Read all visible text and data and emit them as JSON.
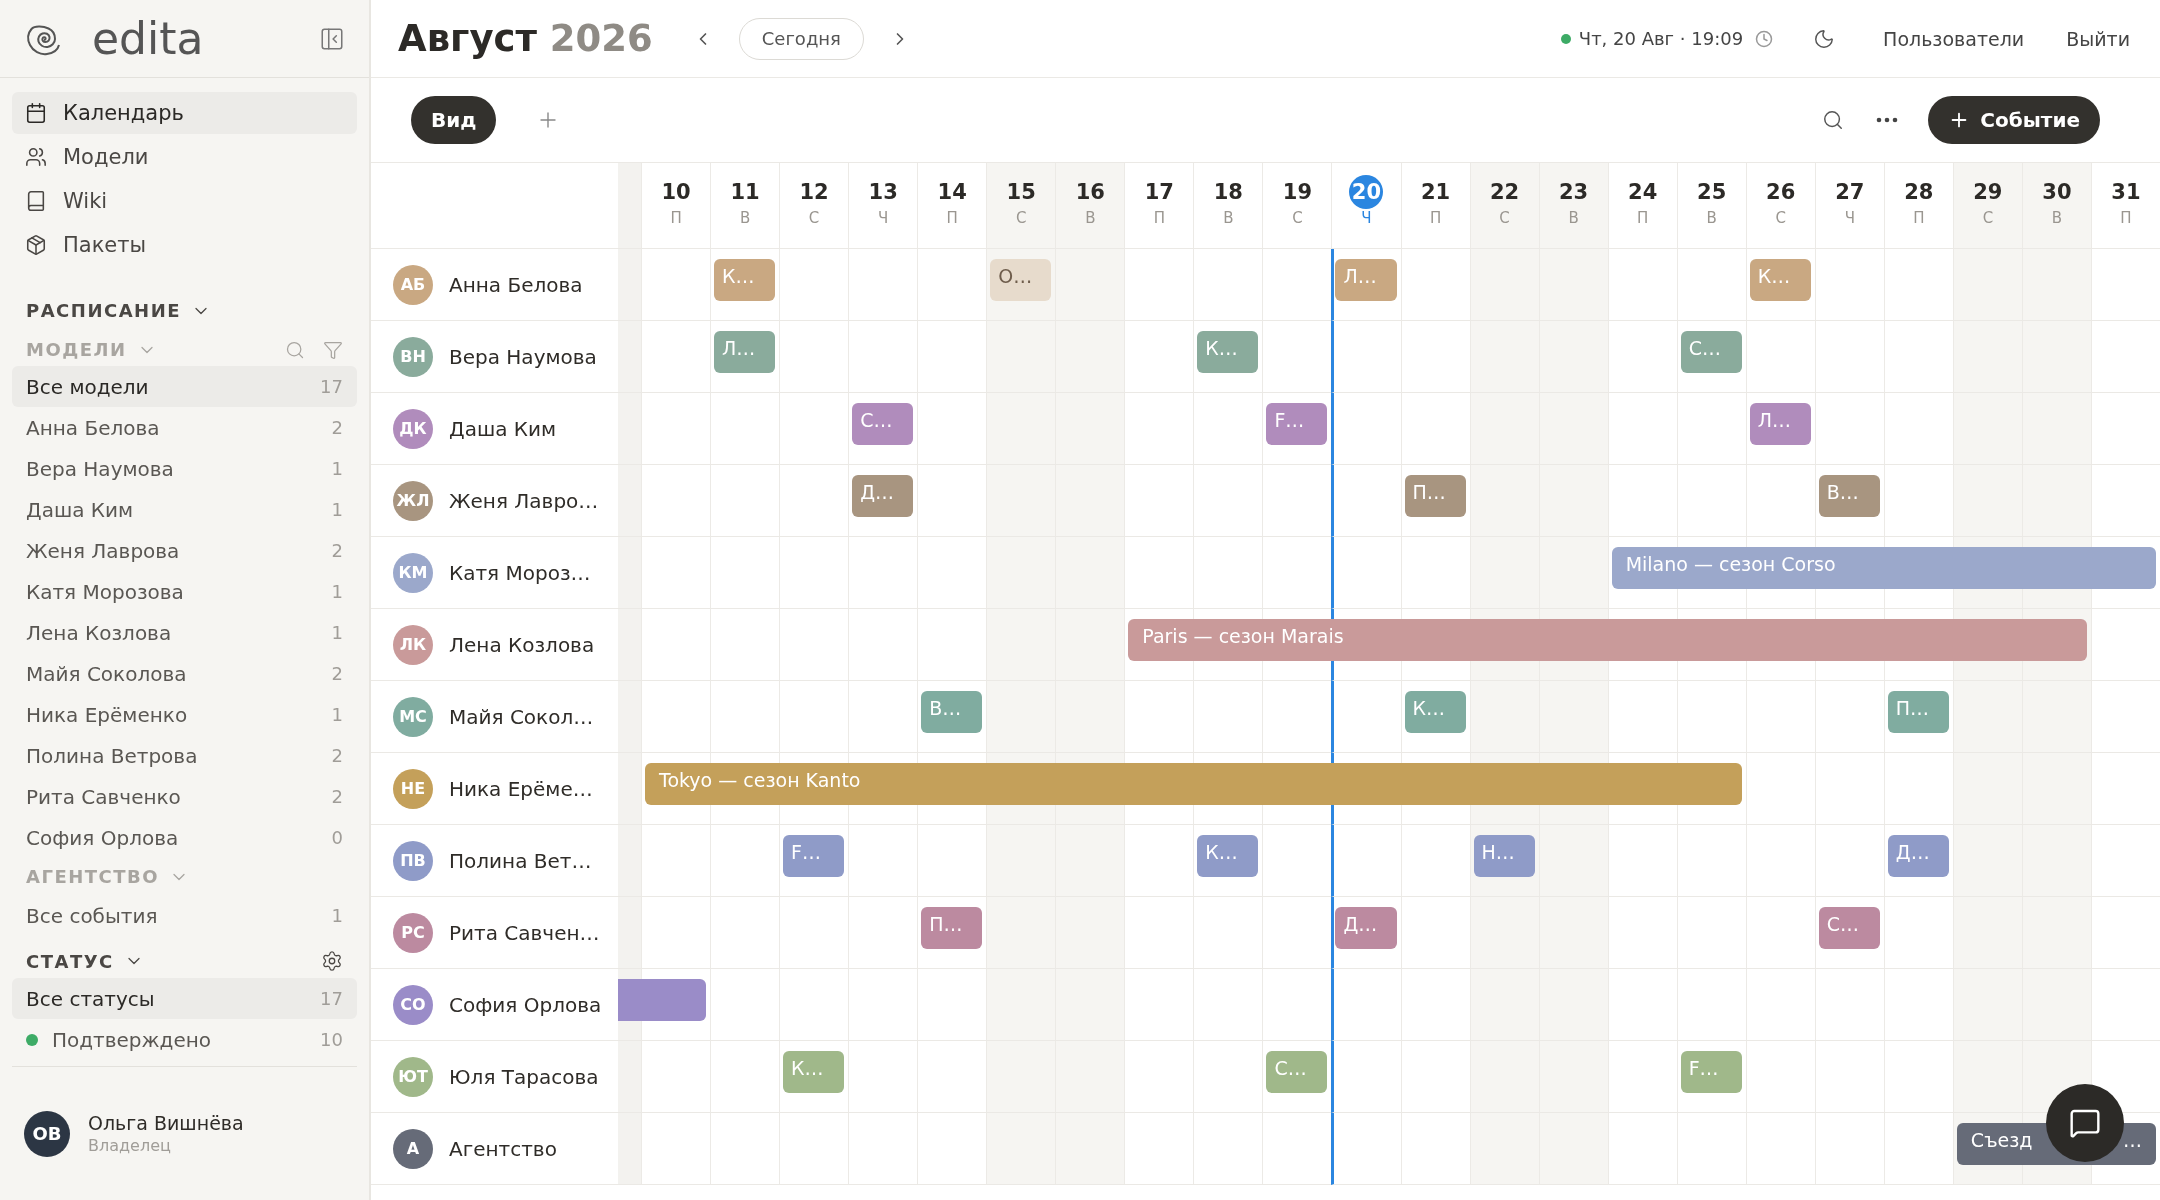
{
  "sidebar": {
    "logo": "edita",
    "nav": [
      {
        "label": "Календарь",
        "selected": true
      },
      {
        "label": "Модели",
        "selected": false
      },
      {
        "label": "Wiki",
        "selected": false
      },
      {
        "label": "Пакеты",
        "selected": false
      }
    ],
    "schedule_heading": "РАСПИСАНИЕ",
    "models_heading": "МОДЕЛИ",
    "models": [
      {
        "name": "Все модели",
        "count": "17",
        "selected": true
      },
      {
        "name": "Анна Белова",
        "count": "2",
        "selected": false
      },
      {
        "name": "Вера Наумова",
        "count": "1",
        "selected": false
      },
      {
        "name": "Даша Ким",
        "count": "1",
        "selected": false
      },
      {
        "name": "Женя Лаврова",
        "count": "2",
        "selected": false
      },
      {
        "name": "Катя Морозова",
        "count": "1",
        "selected": false
      },
      {
        "name": "Лена Козлова",
        "count": "1",
        "selected": false
      },
      {
        "name": "Майя Соколова",
        "count": "2",
        "selected": false
      },
      {
        "name": "Ника Ерёменко",
        "count": "1",
        "selected": false
      },
      {
        "name": "Полина Ветрова",
        "count": "2",
        "selected": false
      },
      {
        "name": "Рита Савченко",
        "count": "2",
        "selected": false
      },
      {
        "name": "София Орлова",
        "count": "0",
        "selected": false
      }
    ],
    "agency_heading": "АГЕНТСТВО",
    "agency": [
      {
        "name": "Все события",
        "count": "1",
        "selected": false
      }
    ],
    "status_heading": "СТАТУС",
    "statuses": [
      {
        "name": "Все статусы",
        "count": "17",
        "selected": true
      },
      {
        "name": "Подтверждено",
        "count": "10",
        "selected": false,
        "color": "#3dab66"
      }
    ],
    "user": {
      "initials": "ОВ",
      "name": "Ольга Вишнёва",
      "role": "Владелец"
    }
  },
  "header": {
    "month": "Август",
    "year": "2026",
    "today_button": "Сегодня",
    "datetime": "Чт, 20 Авг · 19:09",
    "links": [
      "Пользователи",
      "Выйти"
    ]
  },
  "toolbar": {
    "view_button": "Вид",
    "event_button": "Событие"
  },
  "days": [
    {
      "number": "10",
      "weekday": "П",
      "weekend": false,
      "today": false
    },
    {
      "number": "11",
      "weekday": "В",
      "weekend": false,
      "today": false
    },
    {
      "number": "12",
      "weekday": "С",
      "weekend": false,
      "today": false
    },
    {
      "number": "13",
      "weekday": "Ч",
      "weekend": false,
      "today": false
    },
    {
      "number": "14",
      "weekday": "П",
      "weekend": false,
      "today": false
    },
    {
      "number": "15",
      "weekday": "С",
      "weekend": true,
      "today": false
    },
    {
      "number": "16",
      "weekday": "В",
      "weekend": true,
      "today": false
    },
    {
      "number": "17",
      "weekday": "П",
      "weekend": false,
      "today": false
    },
    {
      "number": "18",
      "weekday": "В",
      "weekend": false,
      "today": false
    },
    {
      "number": "19",
      "weekday": "С",
      "weekend": false,
      "today": false
    },
    {
      "number": "20",
      "weekday": "Ч",
      "weekend": false,
      "today": true
    },
    {
      "number": "21",
      "weekday": "П",
      "weekend": false,
      "today": false
    },
    {
      "number": "22",
      "weekday": "С",
      "weekend": true,
      "today": false
    },
    {
      "number": "23",
      "weekday": "В",
      "weekend": true,
      "today": false
    },
    {
      "number": "24",
      "weekday": "П",
      "weekend": false,
      "today": false
    },
    {
      "number": "25",
      "weekday": "В",
      "weekend": false,
      "today": false
    },
    {
      "number": "26",
      "weekday": "С",
      "weekend": false,
      "today": false
    },
    {
      "number": "27",
      "weekday": "Ч",
      "weekend": false,
      "today": false
    },
    {
      "number": "28",
      "weekday": "П",
      "weekend": false,
      "today": false
    },
    {
      "number": "29",
      "weekday": "С",
      "weekend": true,
      "today": false
    },
    {
      "number": "30",
      "weekday": "В",
      "weekend": true,
      "today": false
    },
    {
      "number": "31",
      "weekday": "П",
      "weekend": false,
      "today": false
    }
  ],
  "rows": [
    {
      "initials": "АБ",
      "name": "Анна Белова",
      "color": "#c9a882",
      "cells": [
        null,
        {
          "kind": "start",
          "text": "К…",
          "faded": false
        },
        null,
        null,
        null,
        {
          "kind": "start",
          "text": "О…",
          "faded": true
        },
        null,
        null,
        null,
        null,
        {
          "kind": "start",
          "text": "Л…",
          "faded": false
        },
        null,
        null,
        null,
        null,
        null,
        {
          "kind": "start",
          "text": "К…",
          "faded": false
        }
      ]
    },
    {
      "initials": "ВН",
      "name": "Вера Наумова",
      "color": "#8aab9c",
      "cells": [
        null,
        {
          "kind": "start",
          "text": "Л…",
          "faded": false
        },
        null,
        null,
        null,
        null,
        null,
        null,
        {
          "kind": "start",
          "text": "К…",
          "faded": false
        },
        null,
        null,
        null,
        null,
        null,
        null,
        {
          "kind": "start",
          "text": "С…",
          "faded": false
        }
      ]
    },
    {
      "initials": "ДК",
      "name": "Даша Ким",
      "color": "#b08cbc",
      "cells": [
        null,
        null,
        null,
        {
          "kind": "start",
          "text": "С…",
          "faded": false
        },
        null,
        null,
        null,
        null,
        null,
        {
          "kind": "start",
          "text": "F…",
          "faded": false
        },
        null,
        null,
        null,
        null,
        null,
        null,
        {
          "kind": "start",
          "text": "Л…",
          "faded": false
        }
      ]
    },
    {
      "initials": "ЖЛ",
      "name": "Женя Лавро…",
      "color": "#a89580",
      "cells": [
        null,
        null,
        null,
        {
          "kind": "start",
          "text": "Д…",
          "faded": false
        },
        null,
        null,
        null,
        null,
        null,
        null,
        null,
        {
          "kind": "start",
          "text": "П…",
          "faded": false
        },
        null,
        null,
        null,
        null,
        null,
        {
          "kind": "start",
          "text": "В…",
          "faded": false
        }
      ]
    },
    {
      "initials": "КМ",
      "name": "Катя Мороз…",
      "color": "#9ba8cb",
      "cells": [
        null,
        null,
        null,
        null,
        null,
        null,
        null,
        null,
        null,
        null,
        null,
        null,
        null,
        null,
        {
          "kind": "start",
          "text": "Milano — сезон Corso",
          "faded": false
        },
        {
          "kind": "more"
        },
        {
          "kind": "more"
        },
        {
          "kind": "more"
        },
        {
          "kind": "more"
        },
        {
          "kind": "more"
        },
        {
          "kind": "more"
        },
        {
          "kind": "more"
        }
      ]
    },
    {
      "initials": "ЛК",
      "name": "Лена Козлова",
      "color": "#c99a9a",
      "cells": [
        null,
        null,
        null,
        null,
        null,
        null,
        null,
        {
          "kind": "start",
          "text": "Paris — сезон Marais",
          "faded": false
        },
        {
          "kind": "more"
        },
        {
          "kind": "more"
        },
        {
          "kind": "more"
        },
        {
          "kind": "more"
        },
        {
          "kind": "more"
        },
        {
          "kind": "more"
        },
        {
          "kind": "more"
        },
        {
          "kind": "more"
        },
        {
          "kind": "more"
        },
        {
          "kind": "more"
        },
        {
          "kind": "more"
        },
        {
          "kind": "more"
        },
        {
          "kind": "more"
        }
      ]
    },
    {
      "initials": "МС",
      "name": "Майя Сокол…",
      "color": "#80aca0",
      "cells": [
        null,
        null,
        null,
        null,
        {
          "kind": "start",
          "text": "В…",
          "faded": false
        },
        null,
        null,
        null,
        null,
        null,
        null,
        {
          "kind": "start",
          "text": "К…",
          "faded": false
        },
        null,
        null,
        null,
        null,
        null,
        null,
        {
          "kind": "start",
          "text": "П…",
          "faded": false
        }
      ]
    },
    {
      "initials": "НЕ",
      "name": "Ника Ерёме…",
      "color": "#c4a05a",
      "cells": [
        {
          "kind": "start",
          "text": "Tokyo — сезон Kanto",
          "faded": false
        },
        {
          "kind": "more"
        },
        {
          "kind": "more"
        },
        {
          "kind": "more"
        },
        {
          "kind": "more"
        },
        {
          "kind": "more"
        },
        {
          "kind": "more"
        },
        {
          "kind": "more"
        },
        {
          "kind": "more"
        },
        {
          "kind": "more"
        },
        {
          "kind": "more"
        },
        {
          "kind": "more"
        },
        {
          "kind": "more"
        },
        {
          "kind": "more"
        },
        {
          "kind": "more"
        },
        {
          "kind": "more"
        }
      ]
    },
    {
      "initials": "ПВ",
      "name": "Полина Вет…",
      "color": "#8f9bc8",
      "cells": [
        null,
        null,
        {
          "kind": "start",
          "text": "F…",
          "faded": false
        },
        null,
        null,
        null,
        null,
        null,
        {
          "kind": "start",
          "text": "К…",
          "faded": false
        },
        null,
        null,
        null,
        {
          "kind": "start",
          "text": "Н…",
          "faded": false
        },
        null,
        null,
        null,
        null,
        null,
        {
          "kind": "start",
          "text": "Д…",
          "faded": false
        }
      ]
    },
    {
      "initials": "РС",
      "name": "Рита Савчен…",
      "color": "#bc8aa0",
      "cells": [
        null,
        null,
        null,
        null,
        {
          "kind": "start",
          "text": "П…",
          "faded": false
        },
        null,
        null,
        null,
        null,
        null,
        {
          "kind": "start",
          "text": "Д…",
          "faded": false
        },
        null,
        null,
        null,
        null,
        null,
        null,
        {
          "kind": "start",
          "text": "С…",
          "faded": false
        }
      ]
    },
    {
      "initials": "СО",
      "name": "София Орлова",
      "color": "#9a8cc8",
      "cells": [
        {
          "kind": "start",
          "faded": false,
          "continues_left": true
        }
      ]
    },
    {
      "initials": "ЮТ",
      "name": "Юля Тарасова",
      "color": "#a0b88a",
      "cells": [
        null,
        null,
        {
          "kind": "start",
          "text": "К…",
          "faded": false
        },
        null,
        null,
        null,
        null,
        null,
        null,
        {
          "kind": "start",
          "text": "С…",
          "faded": false
        },
        null,
        null,
        null,
        null,
        null,
        {
          "kind": "start",
          "text": "F…",
          "faded": false
        }
      ]
    },
    {
      "initials": "А",
      "name": "Агентство",
      "color": "#666b78",
      "cells": [
        null,
        null,
        null,
        null,
        null,
        null,
        null,
        null,
        null,
        null,
        null,
        null,
        null,
        null,
        null,
        null,
        null,
        null,
        null,
        {
          "kind": "start",
          "text": "Съезд",
          "tail": "…",
          "faded": false
        },
        {
          "kind": "more"
        },
        {
          "kind": "more"
        }
      ]
    }
  ]
}
